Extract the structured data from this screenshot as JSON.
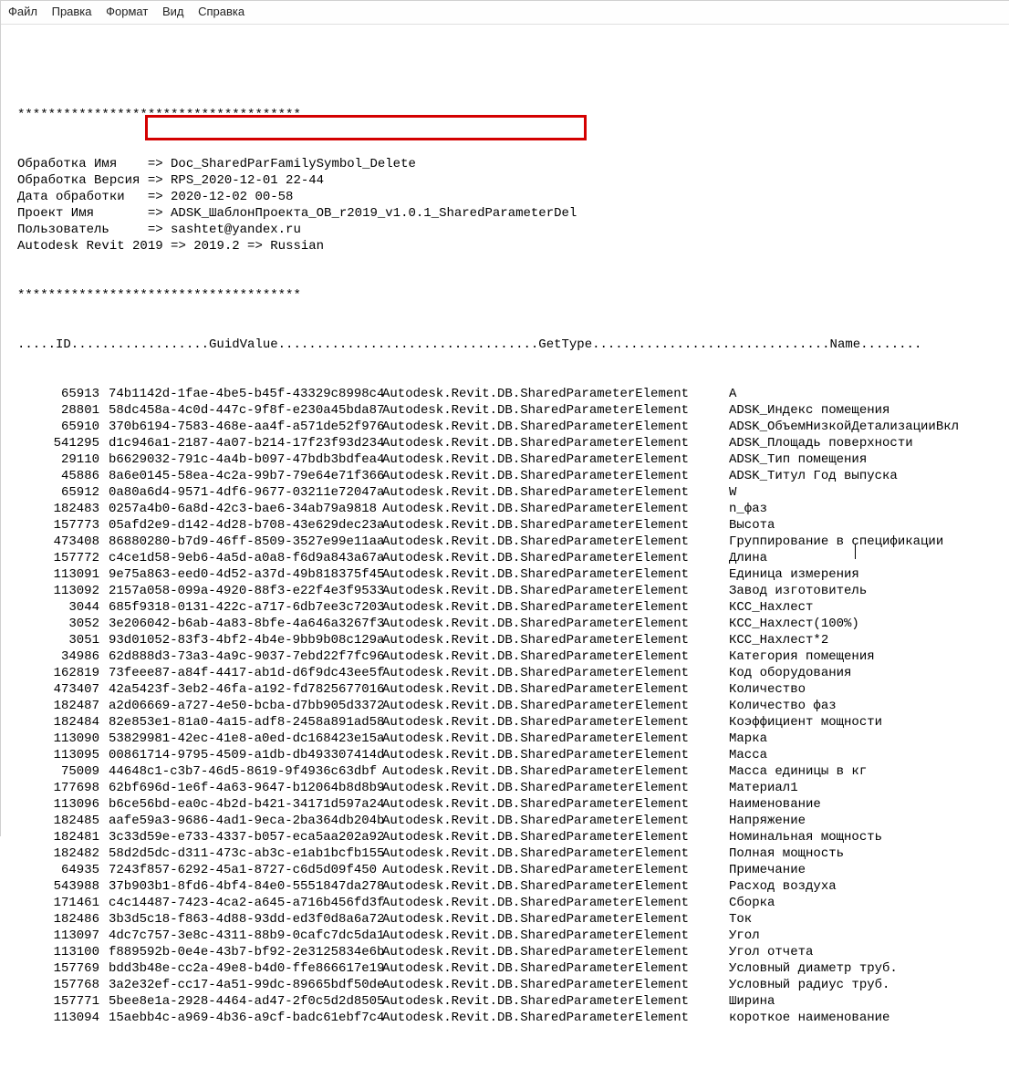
{
  "menu": {
    "items": [
      "Файл",
      "Правка",
      "Формат",
      "Вид",
      "Справка"
    ]
  },
  "header": {
    "stars": "*************************************",
    "lines": [
      {
        "label": "Обработка Имя   ",
        "arrow": " => ",
        "value": "Doc_SharedParFamilySymbol_Delete"
      },
      {
        "label": "Обработка Версия",
        "arrow": " => ",
        "value": "RPS_2020-12-01 22-44"
      },
      {
        "label": "Дата обработки  ",
        "arrow": " => ",
        "value": "2020-12-02 00-58"
      },
      {
        "label": "Проект Имя      ",
        "arrow": " => ",
        "value": "ADSK_ШаблонПроекта_ОВ_r2019_v1.0.1_SharedParameterDel"
      },
      {
        "label": "Пользователь    ",
        "arrow": " => ",
        "value": "sashtet@yandex.ru"
      },
      {
        "label": "Autodesk Revit 2019",
        "arrow": " => ",
        "value": "2019.2 => Russian"
      }
    ]
  },
  "columns_line": ".....ID..................GuidValue..................................GetType...............................Name........",
  "rows": [
    {
      "id": "65913",
      "guid": "74b1142d-1fae-4be5-b45f-43329c8998c4",
      "type": "Autodesk.Revit.DB.SharedParameterElement",
      "name": "А"
    },
    {
      "id": "28801",
      "guid": "58dc458a-4c0d-447c-9f8f-e230a45bda87",
      "type": "Autodesk.Revit.DB.SharedParameterElement",
      "name": "ADSK_Индекс помещения"
    },
    {
      "id": "65910",
      "guid": "370b6194-7583-468e-aa4f-a571de52f976",
      "type": "Autodesk.Revit.DB.SharedParameterElement",
      "name": "ADSK_ОбъемНизкойДетализацииВкл"
    },
    {
      "id": "541295",
      "guid": "d1c946a1-2187-4a07-b214-17f23f93d234",
      "type": "Autodesk.Revit.DB.SharedParameterElement",
      "name": "ADSK_Площадь поверхности"
    },
    {
      "id": "29110",
      "guid": "b6629032-791c-4a4b-b097-47bdb3bdfea4",
      "type": "Autodesk.Revit.DB.SharedParameterElement",
      "name": "ADSK_Тип помещения"
    },
    {
      "id": "45886",
      "guid": "8a6e0145-58ea-4c2a-99b7-79e64e71f366",
      "type": "Autodesk.Revit.DB.SharedParameterElement",
      "name": "ADSK_Титул Год выпуска"
    },
    {
      "id": "65912",
      "guid": "0a80a6d4-9571-4df6-9677-03211e72047a",
      "type": "Autodesk.Revit.DB.SharedParameterElement",
      "name": "W"
    },
    {
      "id": "182483",
      "guid": "0257a4b0-6a8d-42c3-bae6-34ab79a9818",
      "type": "Autodesk.Revit.DB.SharedParameterElement",
      "name": "n_фаз"
    },
    {
      "id": "157773",
      "guid": "05afd2e9-d142-4d28-b708-43e629dec23a",
      "type": "Autodesk.Revit.DB.SharedParameterElement",
      "name": "Высота"
    },
    {
      "id": "473408",
      "guid": "86880280-b7d9-46ff-8509-3527e99e11aa",
      "type": "Autodesk.Revit.DB.SharedParameterElement",
      "name": "Группирование в спецификации"
    },
    {
      "id": "157772",
      "guid": "c4ce1d58-9eb6-4a5d-a0a8-f6d9a843a67a",
      "type": "Autodesk.Revit.DB.SharedParameterElement",
      "name": "Длина"
    },
    {
      "id": "113091",
      "guid": "9e75a863-eed0-4d52-a37d-49b818375f45",
      "type": "Autodesk.Revit.DB.SharedParameterElement",
      "name": "Единица измерения"
    },
    {
      "id": "113092",
      "guid": "2157a058-099a-4920-88f3-e22f4e3f9533",
      "type": "Autodesk.Revit.DB.SharedParameterElement",
      "name": "Завод изготовитель"
    },
    {
      "id": "3044",
      "guid": "685f9318-0131-422c-a717-6db7ee3c7203",
      "type": "Autodesk.Revit.DB.SharedParameterElement",
      "name": "КСС_Нахлест"
    },
    {
      "id": "3052",
      "guid": "3e206042-b6ab-4a83-8bfe-4a646a3267f3",
      "type": "Autodesk.Revit.DB.SharedParameterElement",
      "name": "КСС_Нахлест(100%)"
    },
    {
      "id": "3051",
      "guid": "93d01052-83f3-4bf2-4b4e-9bb9b08c129a",
      "type": "Autodesk.Revit.DB.SharedParameterElement",
      "name": "КСС_Нахлест*2"
    },
    {
      "id": "34986",
      "guid": "62d888d3-73a3-4a9c-9037-7ebd22f7fc96",
      "type": "Autodesk.Revit.DB.SharedParameterElement",
      "name": "Категория помещения"
    },
    {
      "id": "162819",
      "guid": "73feee87-a84f-4417-ab1d-d6f9dc43ee5f",
      "type": "Autodesk.Revit.DB.SharedParameterElement",
      "name": "Код оборудования"
    },
    {
      "id": "473407",
      "guid": "42a5423f-3eb2-46fa-a192-fd7825677016",
      "type": "Autodesk.Revit.DB.SharedParameterElement",
      "name": "Количество"
    },
    {
      "id": "182487",
      "guid": "a2d06669-a727-4e50-bcba-d7bb905d3372",
      "type": "Autodesk.Revit.DB.SharedParameterElement",
      "name": "Количество фаз"
    },
    {
      "id": "182484",
      "guid": "82e853e1-81a0-4a15-adf8-2458a891ad58",
      "type": "Autodesk.Revit.DB.SharedParameterElement",
      "name": "Коэффициент мощности"
    },
    {
      "id": "113090",
      "guid": "53829981-42ec-41e8-a0ed-dc168423e15a",
      "type": "Autodesk.Revit.DB.SharedParameterElement",
      "name": "Марка"
    },
    {
      "id": "113095",
      "guid": "00861714-9795-4509-a1db-db493307414d",
      "type": "Autodesk.Revit.DB.SharedParameterElement",
      "name": "Масса"
    },
    {
      "id": "75009",
      "guid": "44648c1-c3b7-46d5-8619-9f4936c63dbf",
      "type": "Autodesk.Revit.DB.SharedParameterElement",
      "name": "Масса единицы в кг"
    },
    {
      "id": "177698",
      "guid": "62bf696d-1e6f-4a63-9647-b12064b8d8b9",
      "type": "Autodesk.Revit.DB.SharedParameterElement",
      "name": "Материал1"
    },
    {
      "id": "113096",
      "guid": "b6ce56bd-ea0c-4b2d-b421-34171d597a24",
      "type": "Autodesk.Revit.DB.SharedParameterElement",
      "name": "Наименование"
    },
    {
      "id": "182485",
      "guid": "aafe59a3-9686-4ad1-9eca-2ba364db204b",
      "type": "Autodesk.Revit.DB.SharedParameterElement",
      "name": "Напряжение"
    },
    {
      "id": "182481",
      "guid": "3c33d59e-e733-4337-b057-eca5aa202a92",
      "type": "Autodesk.Revit.DB.SharedParameterElement",
      "name": "Номинальная мощность"
    },
    {
      "id": "182482",
      "guid": "58d2d5dc-d311-473c-ab3c-e1ab1bcfb155",
      "type": "Autodesk.Revit.DB.SharedParameterElement",
      "name": "Полная мощность"
    },
    {
      "id": "64935",
      "guid": "7243f857-6292-45a1-8727-c6d5d09f450",
      "type": "Autodesk.Revit.DB.SharedParameterElement",
      "name": "Примечание"
    },
    {
      "id": "543988",
      "guid": "37b903b1-8fd6-4bf4-84e0-5551847da278",
      "type": "Autodesk.Revit.DB.SharedParameterElement",
      "name": "Расход воздуха"
    },
    {
      "id": "171461",
      "guid": "c4c14487-7423-4ca2-a645-a716b456fd3f",
      "type": "Autodesk.Revit.DB.SharedParameterElement",
      "name": "Сборка"
    },
    {
      "id": "182486",
      "guid": "3b3d5c18-f863-4d88-93dd-ed3f0d8a6a72",
      "type": "Autodesk.Revit.DB.SharedParameterElement",
      "name": "Ток"
    },
    {
      "id": "113097",
      "guid": "4dc7c757-3e8c-4311-88b9-0cafc7dc5da1",
      "type": "Autodesk.Revit.DB.SharedParameterElement",
      "name": "Угол"
    },
    {
      "id": "113100",
      "guid": "f889592b-0e4e-43b7-bf92-2e3125834e6b",
      "type": "Autodesk.Revit.DB.SharedParameterElement",
      "name": "Угол отчета"
    },
    {
      "id": "157769",
      "guid": "bdd3b48e-cc2a-49e8-b4d0-ffe866617e19",
      "type": "Autodesk.Revit.DB.SharedParameterElement",
      "name": "Условный диаметр труб."
    },
    {
      "id": "157768",
      "guid": "3a2e32ef-cc17-4a51-99dc-89665bdf50de",
      "type": "Autodesk.Revit.DB.SharedParameterElement",
      "name": "Условный радиус труб."
    },
    {
      "id": "157771",
      "guid": "5bee8e1a-2928-4464-ad47-2f0c5d2d8505",
      "type": "Autodesk.Revit.DB.SharedParameterElement",
      "name": "Ширина"
    },
    {
      "id": "113094",
      "guid": "15aebb4c-a969-4b36-a9cf-badc61ebf7c4",
      "type": "Autodesk.Revit.DB.SharedParameterElement",
      "name": "короткое наименование"
    }
  ]
}
